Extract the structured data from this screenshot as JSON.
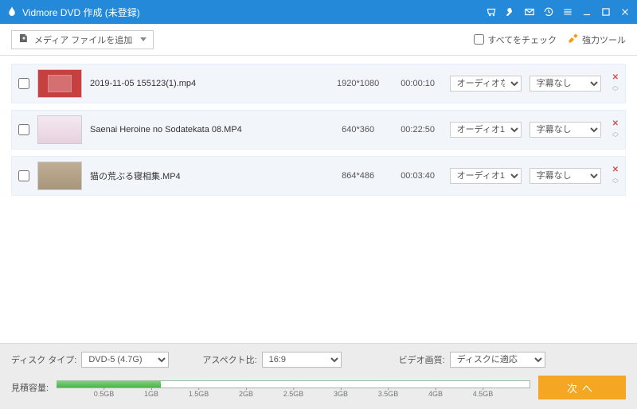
{
  "title": "Vidmore DVD 作成 (未登録)",
  "toolbar": {
    "add_label": "メディア ファイルを追加",
    "checkall_label": "すべてをチェック",
    "tools_label": "強力ツール"
  },
  "rows": [
    {
      "name": "2019-11-05 155123(1).mp4",
      "res": "1920*1080",
      "dur": "00:00:10",
      "audio": "オーディオなし",
      "sub": "字幕なし"
    },
    {
      "name": "Saenai Heroine no Sodatekata 08.MP4",
      "res": "640*360",
      "dur": "00:22:50",
      "audio": "オーディオ1",
      "sub": "字幕なし"
    },
    {
      "name": "猫の荒ぶる寝相集.MP4",
      "res": "864*486",
      "dur": "00:03:40",
      "audio": "オーディオ1",
      "sub": "字幕なし"
    }
  ],
  "footer": {
    "disk_type_label": "ディスク タイプ:",
    "disk_type_value": "DVD-5 (4.7G)",
    "aspect_label": "アスペクト比:",
    "aspect_value": "16:9",
    "quality_label": "ビデオ画質:",
    "quality_value": "ディスクに適応",
    "capacity_label": "見積容量:",
    "next_label": "次へ",
    "ticks": [
      "0.5GB",
      "1GB",
      "1.5GB",
      "2GB",
      "2.5GB",
      "3GB",
      "3.5GB",
      "4GB",
      "4.5GB"
    ],
    "fill_pct": 22
  }
}
